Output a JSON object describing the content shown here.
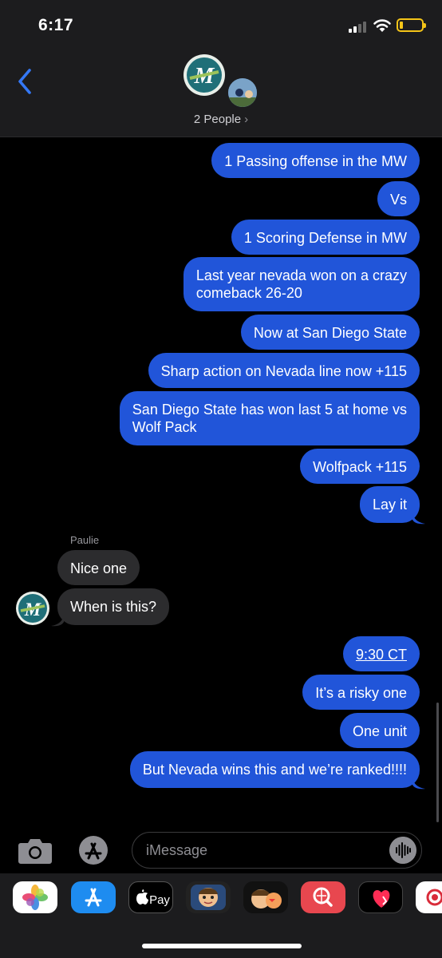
{
  "status_bar": {
    "time": "6:17"
  },
  "header": {
    "people_label": "2 People"
  },
  "conversation": {
    "sender_name": "Paulie",
    "messages": [
      {
        "dir": "out",
        "text": "1 Passing offense in the MW"
      },
      {
        "dir": "out",
        "text": "Vs"
      },
      {
        "dir": "out",
        "text": "1 Scoring Defense in MW"
      },
      {
        "dir": "out",
        "line1": "Last year nevada won on a crazy",
        "line2": "comeback 26-20"
      },
      {
        "dir": "out",
        "text": "Now at San Diego State"
      },
      {
        "dir": "out",
        "text": "Sharp action on Nevada line now +115"
      },
      {
        "dir": "out",
        "line1": "San Diego State has won last 5 at home vs",
        "line2": "Wolf Pack"
      },
      {
        "dir": "out",
        "text": "Wolfpack +115"
      },
      {
        "dir": "out",
        "text": "Lay it"
      },
      {
        "dir": "in",
        "text": "Nice one"
      },
      {
        "dir": "in",
        "text": "When is this?"
      },
      {
        "dir": "out",
        "text": "9:30 CT"
      },
      {
        "dir": "out",
        "text": "It’s a risky one"
      },
      {
        "dir": "out",
        "text": "One unit"
      },
      {
        "dir": "out",
        "text": "But Nevada wins this and we’re ranked!!!!"
      }
    ]
  },
  "composer": {
    "placeholder": "iMessage"
  },
  "app_tray": {
    "apple_pay_label": "Pay",
    "icons": [
      "photos-icon",
      "app-store-icon",
      "apple-pay-icon",
      "memoji-icon",
      "memoji-stickers-icon",
      "web-search-icon",
      "digital-touch-icon",
      "partial-app-icon"
    ]
  },
  "colors": {
    "outgoing_bubble": "#2155d9",
    "incoming_bubble": "#2c2c2e",
    "header_bg": "#1c1c1e"
  }
}
